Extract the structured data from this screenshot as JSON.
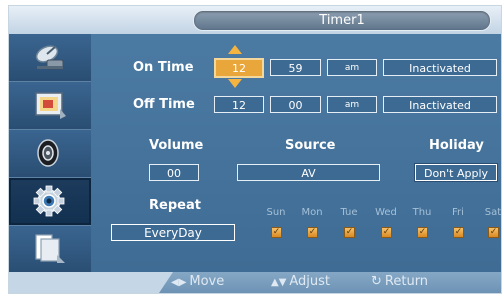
{
  "header": {
    "title": "Timer1"
  },
  "sidebar": {
    "items": [
      {
        "icon": "satellite-dish-icon"
      },
      {
        "icon": "picture-icon"
      },
      {
        "icon": "speaker-icon"
      },
      {
        "icon": "gear-icon",
        "selected": true
      },
      {
        "icon": "multi-window-icon"
      }
    ]
  },
  "on_time": {
    "label": "On Time",
    "hour": "12",
    "minute": "59",
    "ampm": "am",
    "status": "Inactivated"
  },
  "off_time": {
    "label": "Off Time",
    "hour": "12",
    "minute": "00",
    "ampm": "am",
    "status": "Inactivated"
  },
  "volume": {
    "label": "Volume",
    "value": "00"
  },
  "source": {
    "label": "Source",
    "value": "AV"
  },
  "holiday": {
    "label": "Holiday",
    "value": "Don't Apply"
  },
  "repeat": {
    "label": "Repeat",
    "value": "EveryDay",
    "days": [
      {
        "name": "Sun",
        "checked": true
      },
      {
        "name": "Mon",
        "checked": true
      },
      {
        "name": "Tue",
        "checked": true
      },
      {
        "name": "Wed",
        "checked": true
      },
      {
        "name": "Thu",
        "checked": true
      },
      {
        "name": "Fri",
        "checked": true
      },
      {
        "name": "Sat",
        "checked": true
      }
    ]
  },
  "footer": {
    "move": "Move",
    "adjust": "Adjust",
    "return": "Return"
  },
  "colors": {
    "panel": "#3e6a91",
    "selected_field": "#e9a63b",
    "checkbox": "#e8a545"
  }
}
